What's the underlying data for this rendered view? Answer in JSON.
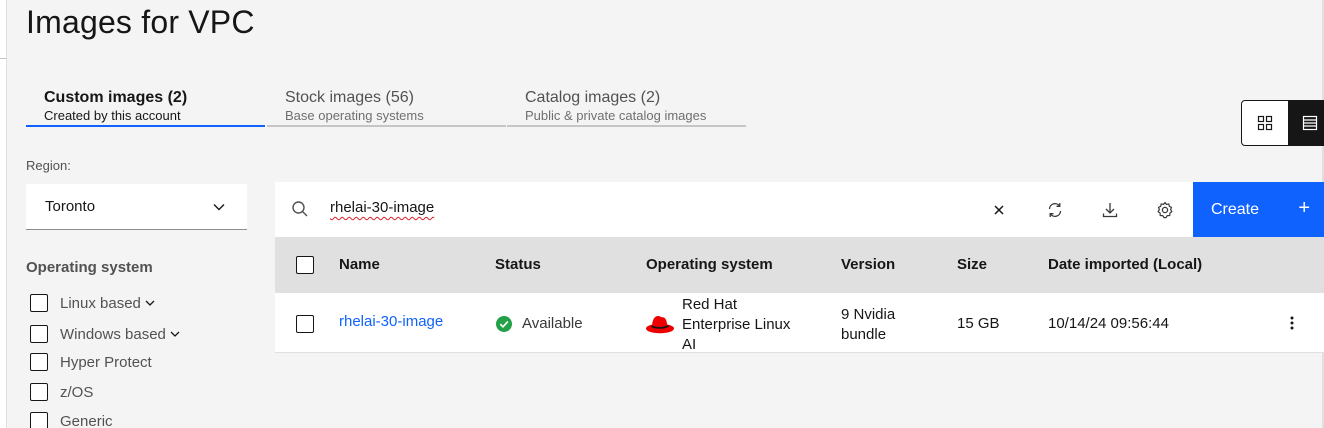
{
  "page": {
    "title": "Images for VPC"
  },
  "tabs": [
    {
      "label": "Custom images (2)",
      "sublabel": "Created by this account",
      "active": true
    },
    {
      "label": "Stock images (56)",
      "sublabel": "Base operating systems",
      "active": false
    },
    {
      "label": "Catalog images (2)",
      "sublabel": "Public & private catalog images",
      "active": false
    }
  ],
  "view_switch": {
    "options": [
      "grid-icon",
      "list-icon"
    ],
    "selected": "list"
  },
  "filters": {
    "region_label": "Region:",
    "region_value": "Toronto",
    "os_title": "Operating system",
    "os_options": [
      {
        "label": "Linux based",
        "expandable": true,
        "checked": false
      },
      {
        "label": "Windows based",
        "expandable": true,
        "checked": false
      },
      {
        "label": "Hyper Protect",
        "expandable": false,
        "checked": false
      },
      {
        "label": "z/OS",
        "expandable": false,
        "checked": false
      },
      {
        "label": "Generic",
        "expandable": false,
        "checked": false
      }
    ]
  },
  "toolbar": {
    "search_value": "rhelai-30-image",
    "icons": [
      "search-icon",
      "clear-icon",
      "refresh-icon",
      "download-icon",
      "settings-icon"
    ],
    "create_label": "Create",
    "create_icon": "+"
  },
  "table": {
    "columns": [
      "Name",
      "Status",
      "Operating system",
      "Version",
      "Size",
      "Date imported (Local)"
    ],
    "rows": [
      {
        "name": "rhelai-30-image",
        "status": "Available",
        "os_line1": "Red Hat",
        "os_line2": "Enterprise Linux",
        "os_line3": "AI",
        "version_line1": "9 Nvidia",
        "version_line2": "bundle",
        "size": "15 GB",
        "date_imported": "10/14/24 09:56:44"
      }
    ]
  },
  "colors": {
    "accent": "#0f62fe",
    "success": "#24a148",
    "redhat": "#ee0000",
    "header_bg": "#e0e0e0"
  }
}
